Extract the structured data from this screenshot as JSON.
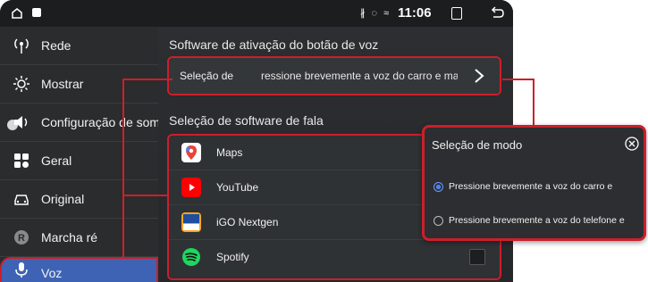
{
  "status_bar": {
    "icons_text": "∦ ◌ ≈",
    "time": "11:06"
  },
  "sidebar": {
    "items": [
      {
        "label": "Rede",
        "icon": "antenna-icon"
      },
      {
        "label": "Mostrar",
        "icon": "brightness-icon"
      },
      {
        "label": "Configuração de som",
        "icon": "speaker-icon"
      },
      {
        "label": "Geral",
        "icon": "grid-icon"
      },
      {
        "label": "Original",
        "icon": "car-icon"
      },
      {
        "label": "Marcha ré",
        "icon": "reverse-r-icon"
      },
      {
        "label": "Voz",
        "icon": "microphone-icon",
        "active": true
      }
    ]
  },
  "main": {
    "voice_section_title": "Software de ativação do botão de voz",
    "voice_row_label": "Seleção de",
    "voice_row_value": "ressione brevemente a voz do carro e mantenh",
    "speech_section_title": "Seleção de software de fala",
    "apps": [
      {
        "name": "Maps",
        "icon": "google-maps-icon"
      },
      {
        "name": "YouTube",
        "icon": "youtube-icon"
      },
      {
        "name": "iGO Nextgen",
        "icon": "igo-icon"
      },
      {
        "name": "Spotify",
        "icon": "spotify-icon"
      }
    ]
  },
  "dialog": {
    "title": "Seleção de modo",
    "options": [
      {
        "label": "Pressione brevemente a voz do carro e",
        "selected": true
      },
      {
        "label": "Pressione brevemente a voz do telefone e",
        "selected": false
      }
    ]
  },
  "colors": {
    "accent": "#3e63b5",
    "annotation_red": "#cc1f2a"
  }
}
